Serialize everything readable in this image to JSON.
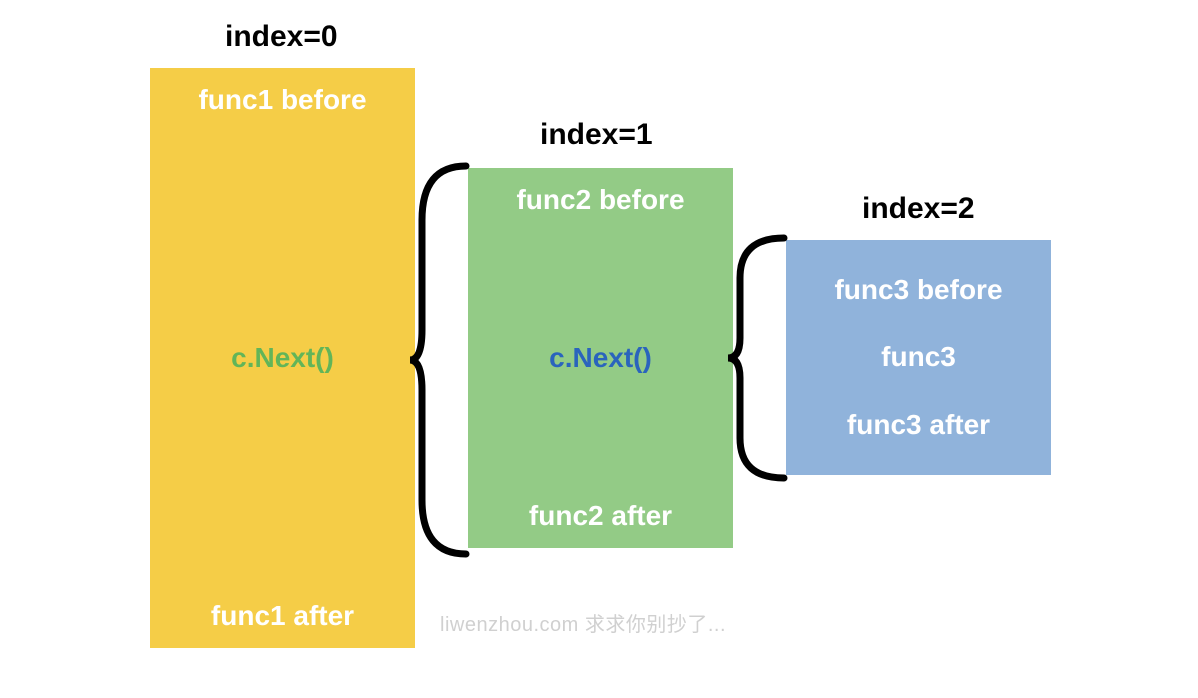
{
  "labels": {
    "index0": "index=0",
    "index1": "index=1",
    "index2": "index=2"
  },
  "box0": {
    "before": "func1 before",
    "next": "c.Next()",
    "after": "func1 after"
  },
  "box1": {
    "before": "func2 before",
    "next": "c.Next()",
    "after": "func2 after"
  },
  "box2": {
    "before": "func3 before",
    "mid": "func3",
    "after": "func3 after"
  },
  "watermark": "liwenzhou.com  求求你别抄了...",
  "colors": {
    "yellow": "#f5cd47",
    "green": "#93cb86",
    "blue": "#90b3db",
    "nextGreen": "#62b558",
    "nextBlue": "#2a64bd"
  }
}
